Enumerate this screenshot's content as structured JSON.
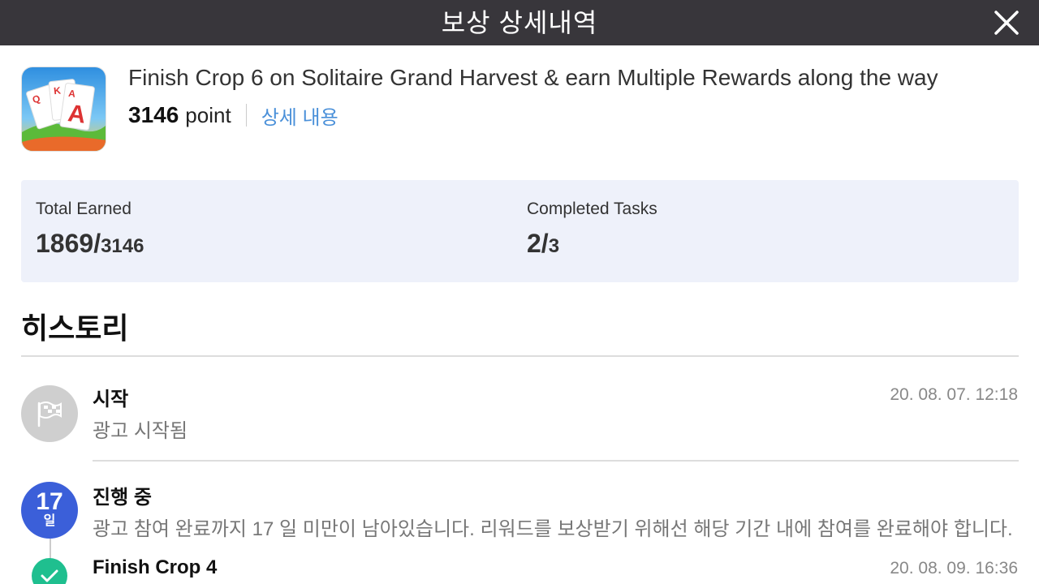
{
  "header": {
    "title": "보상 상세내역",
    "close_icon": "close-icon"
  },
  "offer": {
    "app_icon": "solitaire-cards-icon",
    "title": "Finish Crop 6 on Solitaire Grand Harvest & earn Multiple Rewards along the way",
    "points": "3146",
    "points_unit": "point",
    "detail_link": "상세 내용"
  },
  "stats": {
    "total_earned": {
      "label": "Total Earned",
      "current": "1869/",
      "total": "3146"
    },
    "completed_tasks": {
      "label": "Completed Tasks",
      "current": "2/",
      "total": "3"
    }
  },
  "history": {
    "title": "히스토리",
    "items": [
      {
        "icon": "flag-icon",
        "title": "시작",
        "description": "광고 시작됨",
        "time": "20. 08. 07. 12:18"
      },
      {
        "days": "17",
        "days_unit": "일",
        "title": "진행 중",
        "description": "광고 참여 완료까지 17 일 미만이 남아있습니다. 리워드를 보상받기 위해선 해당 기간 내에 참여를 완료해야 합니다."
      },
      {
        "icon": "check-icon",
        "title": "Finish Crop 4",
        "time": "20. 08. 09. 16:36"
      }
    ]
  },
  "colors": {
    "topbar": "#38363b",
    "link": "#4a90d9",
    "stats_bg": "#eef1fa",
    "days_badge": "#3b5fd9",
    "done_badge": "#1fbf8f"
  }
}
